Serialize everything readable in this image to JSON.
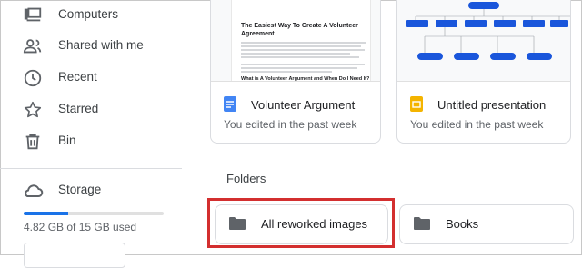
{
  "sidebar": {
    "items": [
      {
        "label": "Computers",
        "icon": "computers-icon"
      },
      {
        "label": "Shared with me",
        "icon": "shared-icon"
      },
      {
        "label": "Recent",
        "icon": "clock-icon"
      },
      {
        "label": "Starred",
        "icon": "star-icon"
      },
      {
        "label": "Bin",
        "icon": "trash-icon"
      }
    ],
    "storage": {
      "label": "Storage",
      "icon": "cloud-icon",
      "used_text": "4.82 GB of 15 GB used",
      "used_fraction": 0.32,
      "accent": "#1a73e8"
    }
  },
  "files": [
    {
      "name": "Volunteer Argument",
      "meta": "You edited in the past week",
      "type": "doc",
      "type_color": "#4285f4",
      "thumb": {
        "title": "The Easiest Way To Create A Volunteer Agreement",
        "subheading": "What is A Volunteer Argument and When Do I Need It?"
      }
    },
    {
      "name": "Untitled presentation",
      "meta": "You edited in the past week",
      "type": "slides",
      "type_color": "#f4b400"
    }
  ],
  "folders_heading": "Folders",
  "folders": [
    {
      "name": "All reworked images",
      "icon": "folder-icon",
      "highlighted": true
    },
    {
      "name": "Books",
      "icon": "folder-icon",
      "highlighted": false
    }
  ],
  "colors": {
    "highlight": "#d32f2f",
    "diagram_node": "#1a56db"
  }
}
